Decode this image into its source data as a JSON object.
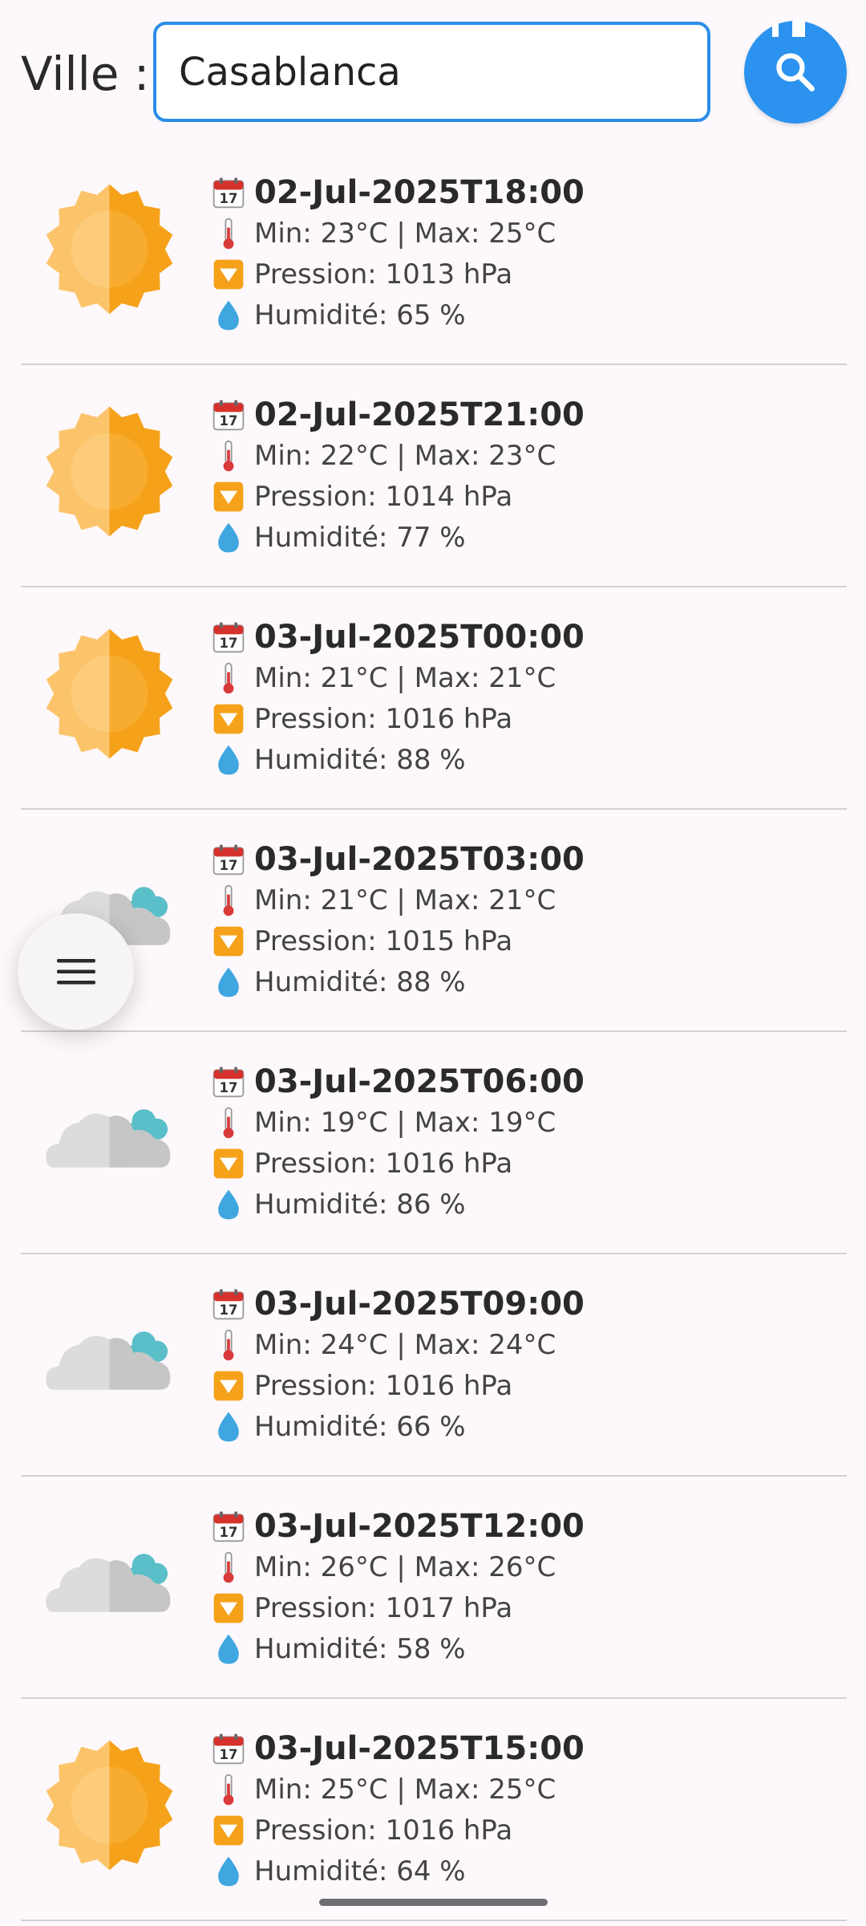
{
  "search": {
    "label": "Ville :",
    "value": "Casablanca"
  },
  "icons": {
    "search_button": "search-icon",
    "menu_button": "hamburger-menu-icon",
    "date": "calendar-icon",
    "temperature": "thermometer-icon",
    "pressure": "down-arrow-button-icon",
    "humidity": "droplet-icon"
  },
  "colors": {
    "accent": "#2b93ef",
    "input_border": "#2b8de8",
    "sun_light": "#fcc46a",
    "sun_dark": "#f5a21a",
    "cloud_light": "#dcdcdc",
    "cloud_dark": "#c6c6c6",
    "cloud_accent": "#5bbfc9"
  },
  "forecasts": [
    {
      "condition": "sun",
      "date": "02-Jul-2025T18:00",
      "temp": "Min: 23°C | Max: 25°C",
      "pressure": "Pression: 1013 hPa",
      "humidity": "Humidité: 65 %"
    },
    {
      "condition": "sun",
      "date": "02-Jul-2025T21:00",
      "temp": "Min: 22°C | Max: 23°C",
      "pressure": "Pression: 1014 hPa",
      "humidity": "Humidité: 77 %"
    },
    {
      "condition": "sun",
      "date": "03-Jul-2025T00:00",
      "temp": "Min: 21°C | Max: 21°C",
      "pressure": "Pression: 1016 hPa",
      "humidity": "Humidité: 88 %"
    },
    {
      "condition": "cloud",
      "date": "03-Jul-2025T03:00",
      "temp": "Min: 21°C | Max: 21°C",
      "pressure": "Pression: 1015 hPa",
      "humidity": "Humidité: 88 %"
    },
    {
      "condition": "cloud",
      "date": "03-Jul-2025T06:00",
      "temp": "Min: 19°C | Max: 19°C",
      "pressure": "Pression: 1016 hPa",
      "humidity": "Humidité: 86 %"
    },
    {
      "condition": "cloud",
      "date": "03-Jul-2025T09:00",
      "temp": "Min: 24°C | Max: 24°C",
      "pressure": "Pression: 1016 hPa",
      "humidity": "Humidité: 66 %"
    },
    {
      "condition": "cloud",
      "date": "03-Jul-2025T12:00",
      "temp": "Min: 26°C | Max: 26°C",
      "pressure": "Pression: 1017 hPa",
      "humidity": "Humidité: 58 %"
    },
    {
      "condition": "sun",
      "date": "03-Jul-2025T15:00",
      "temp": "Min: 25°C | Max: 25°C",
      "pressure": "Pression: 1016 hPa",
      "humidity": "Humidité: 64 %"
    }
  ]
}
